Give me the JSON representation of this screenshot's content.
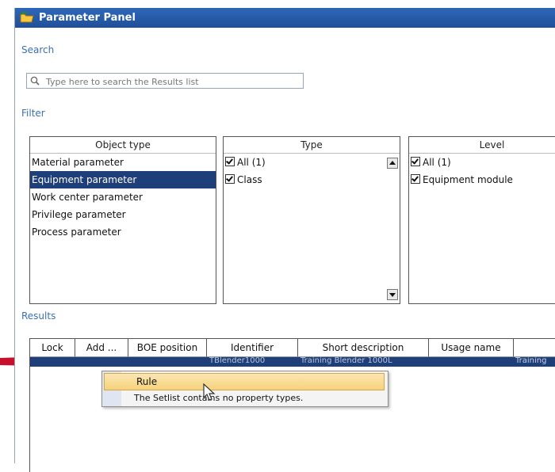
{
  "window": {
    "title": "Parameter Panel"
  },
  "sections": {
    "search": "Search",
    "filter": "Filter",
    "results": "Results"
  },
  "search": {
    "placeholder": "Type here to search the Results list"
  },
  "filter": {
    "object_type": {
      "header": "Object type",
      "items": [
        "Material parameter",
        "Equipment parameter",
        "Work center parameter",
        "Privilege parameter",
        "Process parameter"
      ],
      "selected_index": 1
    },
    "type": {
      "header": "Type",
      "items": [
        {
          "label": "All (1)",
          "checked": true
        },
        {
          "label": "Class",
          "checked": true
        }
      ]
    },
    "level": {
      "header": "Level",
      "items": [
        {
          "label": "All (1)",
          "checked": true
        },
        {
          "label": "Equipment module",
          "checked": true
        }
      ]
    }
  },
  "results": {
    "columns": [
      "Lock",
      "Add ...",
      "BOE position",
      "Identifier",
      "Short description",
      "Usage name",
      ""
    ],
    "row": {
      "identifier": "TBlender1000",
      "short_description": "Training Blender 1000L",
      "last": "Training"
    }
  },
  "context_menu": {
    "items": [
      "Rule"
    ],
    "message": "The Setlist contains no property types."
  },
  "colors": {
    "title_bar": "#2f67b8",
    "selection": "#1e3f7a",
    "section_label": "#3d6fb4",
    "annotation_arrow": "#c8102e",
    "menu_highlight": "#f6d27a"
  }
}
